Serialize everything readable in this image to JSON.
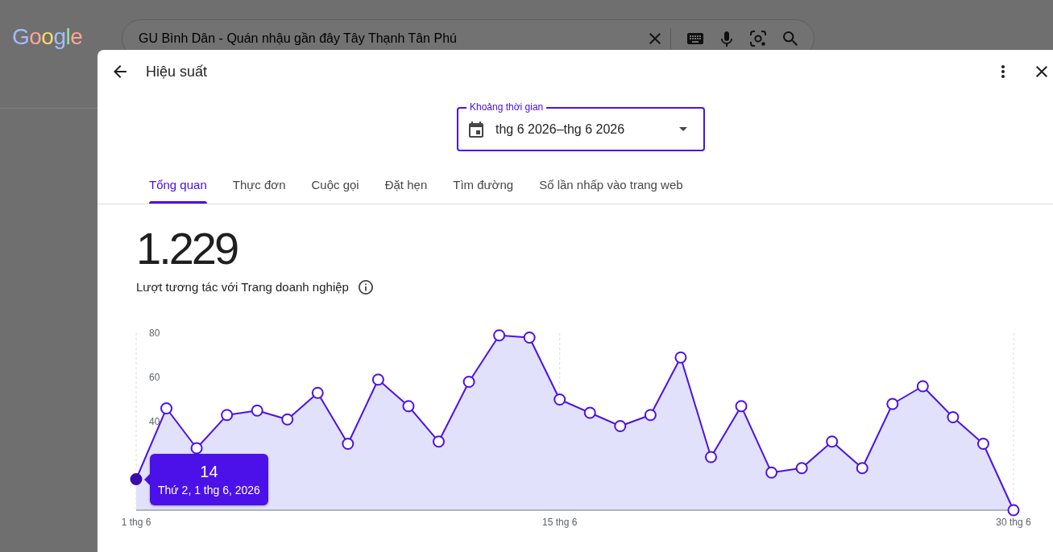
{
  "background_page": {
    "logo": "Google",
    "search": {
      "value": "GU Bình Dân - Quán nhậu gần đây Tây Thạnh Tân Phú"
    }
  },
  "dialog": {
    "title": "Hiệu suất",
    "date_range": {
      "label": "Khoảng thời gian",
      "value": "thg 6 2026–thg 6 2026"
    },
    "tabs": [
      {
        "label": "Tổng quan",
        "selected": true
      },
      {
        "label": "Thực đơn",
        "selected": false
      },
      {
        "label": "Cuộc gọi",
        "selected": false
      },
      {
        "label": "Đặt hẹn",
        "selected": false
      },
      {
        "label": "Tìm đường",
        "selected": false
      },
      {
        "label": "Số lần nhấp vào trang web",
        "selected": false
      }
    ],
    "metric": {
      "value": "1.229",
      "label": "Lượt tương tác với Trang doanh nghiệp"
    },
    "chart": {
      "tooltip_value": "14",
      "chart_data": {
        "type": "area",
        "categories": [
          "1 thg 6",
          null,
          null,
          null,
          null,
          null,
          null,
          null,
          null,
          null,
          null,
          null,
          null,
          null,
          "15 thg 6",
          null,
          null,
          null,
          null,
          null,
          null,
          null,
          null,
          null,
          null,
          null,
          null,
          null,
          null,
          "30 thg 6"
        ],
        "series": [
          {
            "color": "#4b11e8",
            "values": [
              14,
              46,
              28,
              43,
              45,
              41,
              53,
              30,
              59,
              47,
              31,
              58,
              79,
              78,
              50,
              44,
              38,
              43,
              69,
              24,
              47,
              17,
              19,
              31,
              19,
              48,
              56,
              42,
              30,
              0
            ]
          }
        ],
        "ylim": [
          0,
          80
        ],
        "yticks": [
          40,
          60,
          80
        ],
        "annotations": [
          {
            "x": "1 thg 6",
            "y": 14,
            "text": "Thứ 2, 1 thg 6, 2026"
          }
        ]
      }
    }
  }
}
